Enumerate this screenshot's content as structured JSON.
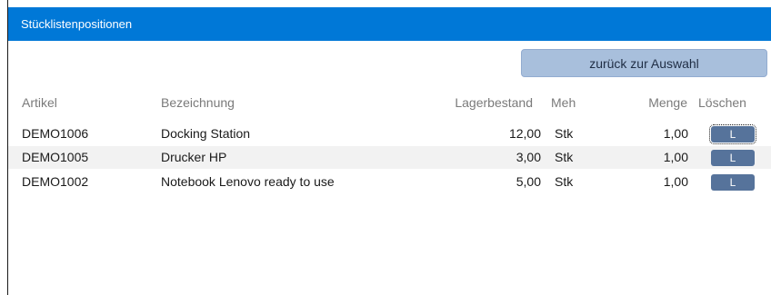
{
  "window": {
    "title": "Stücklistenpositionen"
  },
  "toolbar": {
    "back_label": "zurück zur Auswahl"
  },
  "table": {
    "headers": {
      "artikel": "Artikel",
      "bezeichnung": "Bezeichnung",
      "lagerbestand": "Lagerbestand",
      "meh": "Meh",
      "menge": "Menge",
      "loeschen": "Löschen"
    },
    "rows": [
      {
        "artikel": "DEMO1006",
        "bezeichnung": "Docking Station",
        "lagerbestand": "12,00",
        "meh": "Stk",
        "menge": "1,00",
        "delete_label": "L"
      },
      {
        "artikel": "DEMO1005",
        "bezeichnung": "Drucker HP",
        "lagerbestand": "3,00",
        "meh": "Stk",
        "menge": "1,00",
        "delete_label": "L"
      },
      {
        "artikel": "DEMO1002",
        "bezeichnung": "Notebook Lenovo ready to use",
        "lagerbestand": "5,00",
        "meh": "Stk",
        "menge": "1,00",
        "delete_label": "L"
      }
    ]
  },
  "colors": {
    "title_bar": "#0078d7",
    "back_button": "#a8bfdc",
    "delete_button": "#56739b",
    "alt_row": "#f2f2f2"
  }
}
